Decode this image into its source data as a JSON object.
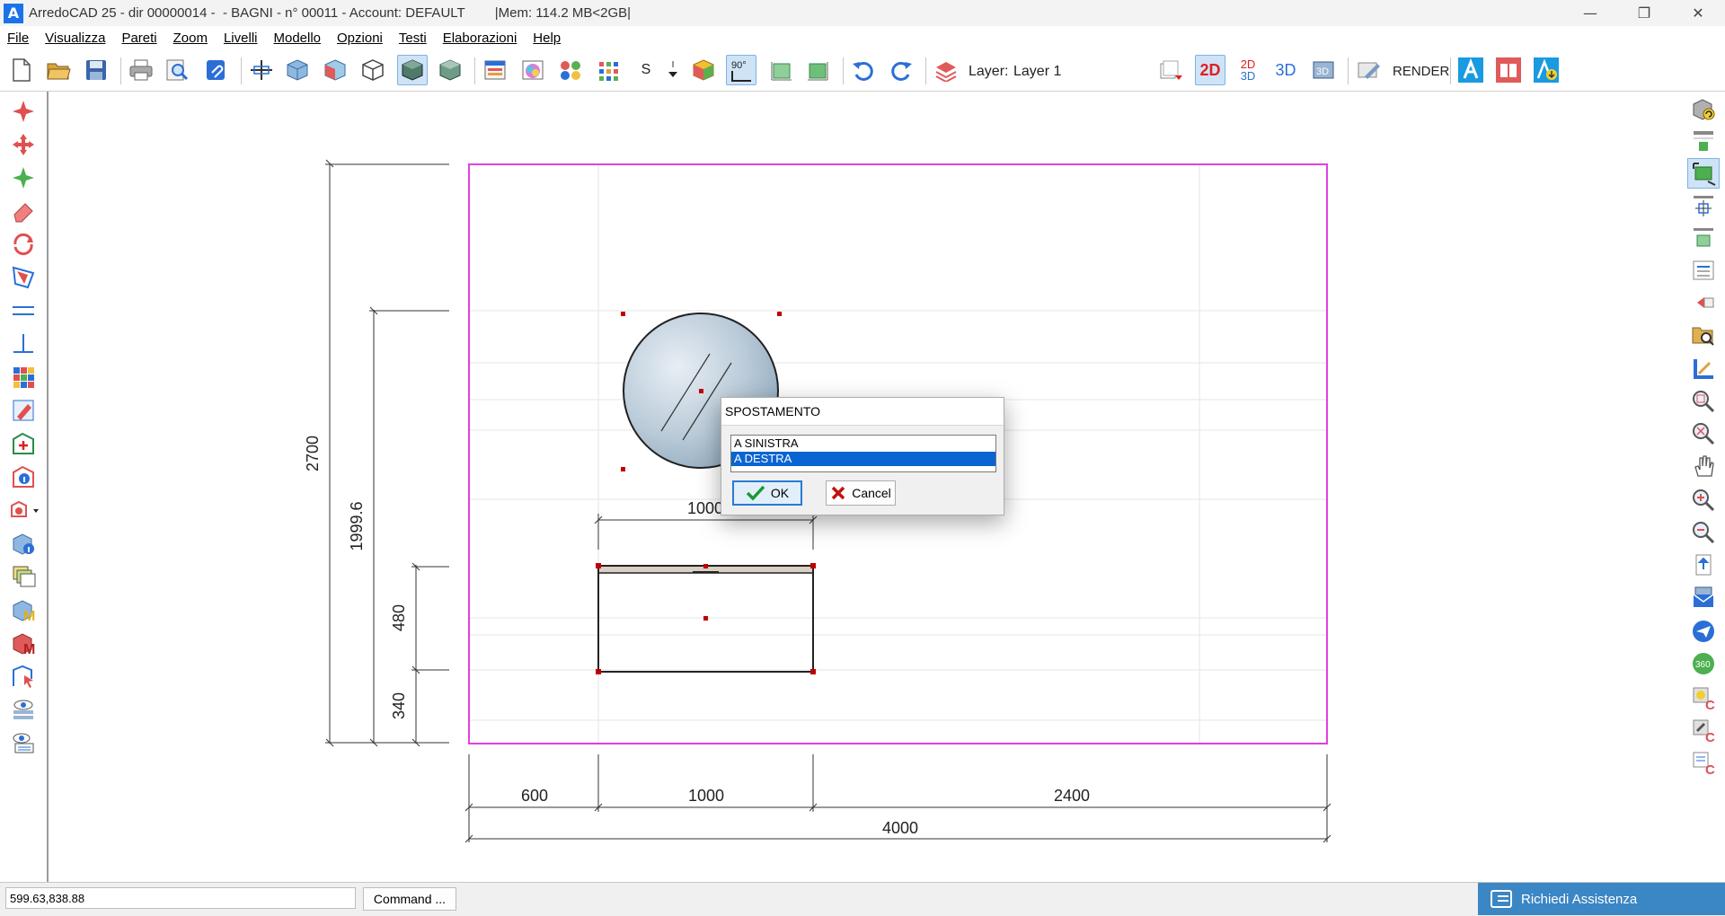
{
  "window": {
    "logo": "A",
    "title": "ArredoCAD 25 - dir 00000014 -  - BAGNI - n° 00011 - Account: DEFAULT        |Mem: 114.2 MB<2GB|",
    "minimize": "—",
    "restore": "❐",
    "close": "✕"
  },
  "menu": [
    {
      "label": "File"
    },
    {
      "label": "Visualizza"
    },
    {
      "label": "Pareti"
    },
    {
      "label": "Zoom"
    },
    {
      "label": "Livelli"
    },
    {
      "label": "Modello"
    },
    {
      "label": "Opzioni"
    },
    {
      "label": "Testi"
    },
    {
      "label": "Elaborazioni"
    },
    {
      "label": "Help"
    }
  ],
  "toolbar": {
    "s_label": "S",
    "angle_label": "90°",
    "layer_label": "Layer:",
    "layer_value": "Layer 1",
    "view_2d": "2D",
    "view_2d3d_top": "2D",
    "view_2d3d_bottom": "3D",
    "view_3d": "3D",
    "view_3d_box": "3D",
    "render_label": "RENDER",
    "accent_red": "#e02020",
    "accent_blue": "#2b6fd6"
  },
  "drawing": {
    "dim_total_height": "2700",
    "dim_mirror_height": "1999.6",
    "dim_cabinet_height": "480",
    "dim_base_height": "340",
    "dim_mirror_width": "1000",
    "dim_left": "600",
    "dim_middle": "1000",
    "dim_right": "2400",
    "dim_total_width": "4000",
    "wall_color": "#e040e0"
  },
  "dialog": {
    "title": "SPOSTAMENTO",
    "options": [
      "A SINISTRA",
      "A DESTRA"
    ],
    "selected_index": 1,
    "ok_label": "OK",
    "cancel_label": "Cancel"
  },
  "status": {
    "coordinates": "599.63,838.88",
    "command_label": "Command ...",
    "assist_label": "Richiedi Assistenza"
  }
}
